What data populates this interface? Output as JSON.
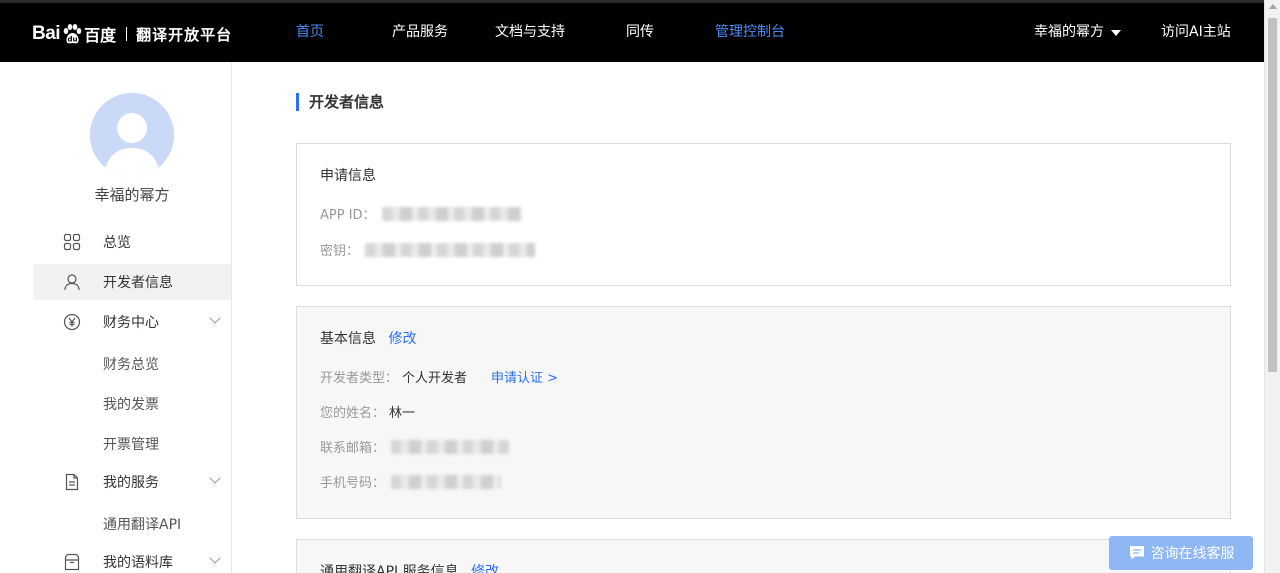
{
  "header": {
    "logo_bai": "Bai",
    "logo_du": "百度",
    "platform_title": "翻译开放平台",
    "nav": [
      {
        "label": "首页",
        "active": true
      },
      {
        "label": "产品服务",
        "active": false
      },
      {
        "label": "文档与支持",
        "active": false
      },
      {
        "label": "同传",
        "active": false
      },
      {
        "label": "管理控制台",
        "active": true
      }
    ],
    "user_name": "幸福的幂方",
    "visit_ai_label": "访问AI主站"
  },
  "sidebar": {
    "username": "幸福的幂方",
    "items": [
      {
        "label": "总览",
        "icon": "grid-icon"
      },
      {
        "label": "开发者信息",
        "icon": "user-icon",
        "active": true
      },
      {
        "label": "财务中心",
        "icon": "yen-icon",
        "expandable": true
      },
      {
        "label": "我的服务",
        "icon": "document-icon",
        "expandable": true
      },
      {
        "label": "我的语料库",
        "icon": "archive-icon",
        "expandable": true
      }
    ],
    "finance_sub": [
      "财务总览",
      "我的发票",
      "开票管理"
    ],
    "service_sub": [
      "通用翻译API"
    ]
  },
  "main": {
    "page_title": "开发者信息",
    "apply_info": {
      "title": "申请信息",
      "app_id_label": "APP ID：",
      "secret_label": "密钥："
    },
    "basic_info": {
      "title": "基本信息",
      "edit_label": "修改",
      "dev_type_label": "开发者类型：",
      "dev_type_value": "个人开发者",
      "apply_cert_label": "申请认证 >",
      "name_label": "您的姓名：",
      "name_value": "林一",
      "email_label": "联系邮箱：",
      "phone_label": "手机号码："
    },
    "api_info": {
      "title": "通用翻译API 服务信息",
      "edit_label": "修改"
    }
  },
  "float_button": {
    "label": "咨询在线客服"
  },
  "colors": {
    "accent": "#2a6ff6",
    "nav_active": "#4b8bf4",
    "topbar": "#000000"
  }
}
